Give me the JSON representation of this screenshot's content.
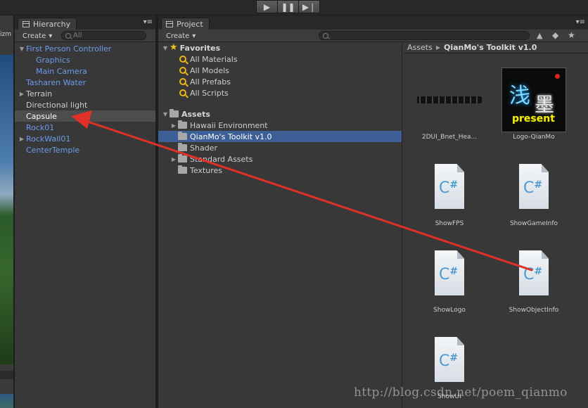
{
  "toolbar": {
    "play_icon": "play-icon",
    "pause_icon": "pause-icon",
    "step_icon": "step-icon"
  },
  "scene": {
    "gizmo_label": "izm"
  },
  "hierarchy": {
    "tab_label": "Hierarchy",
    "create_label": "Create",
    "search_placeholder": "All",
    "items": [
      {
        "label": "First Person Controller",
        "style": "prefab",
        "expanded": true,
        "indent": 0
      },
      {
        "label": "Graphics",
        "style": "prefab",
        "indent": 1
      },
      {
        "label": "Main Camera",
        "style": "prefab",
        "indent": 1
      },
      {
        "label": "Tasharen Water",
        "style": "prefab",
        "indent": 0
      },
      {
        "label": "Terrain",
        "style": "plain",
        "collapsed": true,
        "indent": 0
      },
      {
        "label": "Directional light",
        "style": "plain",
        "indent": 0
      },
      {
        "label": "Capsule",
        "style": "plain",
        "selected": true,
        "indent": 0
      },
      {
        "label": "Rock01",
        "style": "prefab",
        "indent": 0
      },
      {
        "label": "RockWall01",
        "style": "prefab",
        "collapsed": true,
        "indent": 0
      },
      {
        "label": "CenterTemple",
        "style": "prefab",
        "indent": 0
      }
    ]
  },
  "project": {
    "tab_label": "Project",
    "create_label": "Create",
    "favorites": {
      "label": "Favorites",
      "items": [
        "All Materials",
        "All Models",
        "All Prefabs",
        "All Scripts"
      ]
    },
    "assets": {
      "label": "Assets",
      "folders": [
        {
          "label": "Hawaii Environment",
          "collapsed": true
        },
        {
          "label": "QianMo's Toolkit v1.0",
          "selected": true
        },
        {
          "label": "Shader"
        },
        {
          "label": "Standard Assets",
          "collapsed": true
        },
        {
          "label": "Textures"
        }
      ]
    },
    "breadcrumb": {
      "root": "Assets",
      "current": "QianMo's Toolkit v1.0"
    },
    "grid_items": [
      {
        "name": "2DUI_Bnet_Hea...",
        "kind": "texture-banner"
      },
      {
        "name": "Logo-QianMo",
        "kind": "texture-logo",
        "logo_text": "present",
        "logo_glyph_1": "浅",
        "logo_glyph_2": "墨"
      },
      {
        "name": "ShowFPS",
        "kind": "csharp-script"
      },
      {
        "name": "ShowGameInfo",
        "kind": "csharp-script"
      },
      {
        "name": "ShowLogo",
        "kind": "csharp-script"
      },
      {
        "name": "ShowObjectInfo",
        "kind": "csharp-script"
      },
      {
        "name": "ShowUI",
        "kind": "csharp-script"
      }
    ],
    "cs_glyph": "C",
    "cs_hash": "#"
  },
  "watermark": "http://blog.csdn.net/poem_qianmo",
  "colors": {
    "prefab_text": "#6d9bea",
    "selection": "#3e5f96",
    "annotation_arrow": "#e0302a"
  }
}
